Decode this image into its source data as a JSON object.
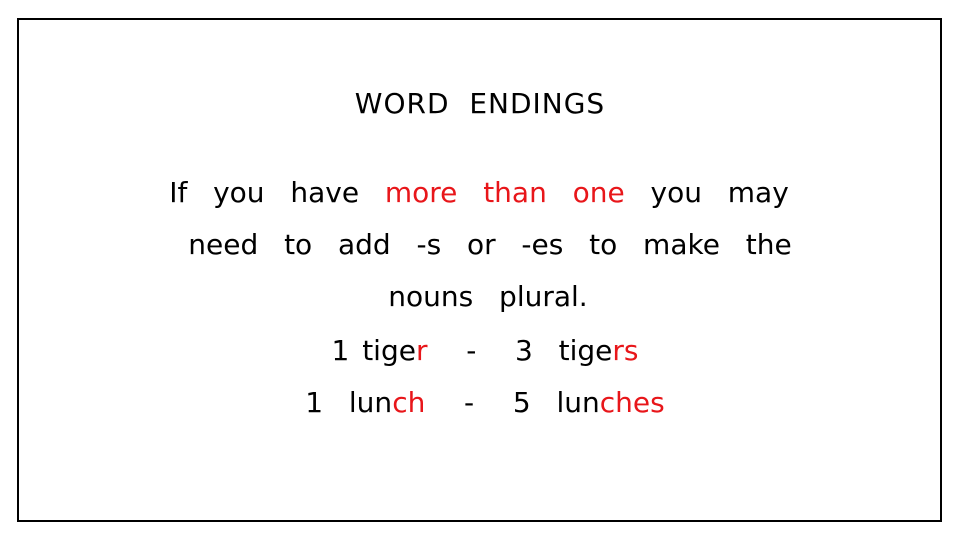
{
  "slide": {
    "title": "WORD  ENDINGS",
    "colors": {
      "text": "#000000",
      "highlight": "#e8161a",
      "border": "#000000",
      "background": "#ffffff"
    },
    "paragraph": {
      "line1": {
        "before": "If  you  have  ",
        "highlight": "more  than  one",
        "after": "  you  may"
      },
      "line2": "need  to  add  -s  or  -es  to  make  the",
      "line3": "nouns  plural."
    },
    "examples": [
      {
        "singular_count": "1",
        "singular_stem": "tige",
        "singular_ending": "r",
        "separator": "-",
        "plural_count": "3",
        "plural_stem": "tige",
        "plural_ending": "rs"
      },
      {
        "singular_count": "1",
        "singular_stem": "lun",
        "singular_ending": "ch",
        "separator": "-",
        "plural_count": "5",
        "plural_stem": "lun",
        "plural_ending": "ches"
      }
    ]
  }
}
